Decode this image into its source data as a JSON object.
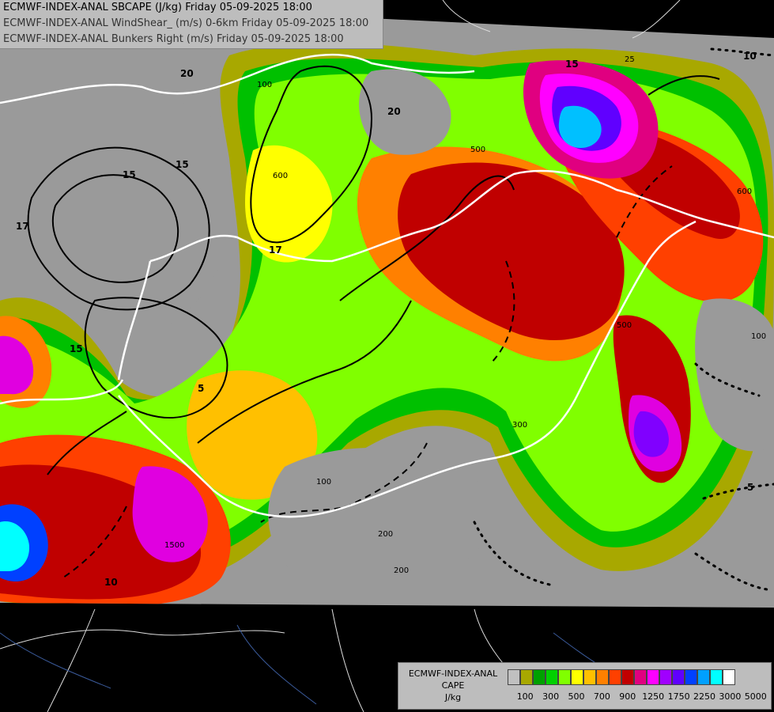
{
  "header": {
    "line1": "ECMWF-INDEX-ANAL SBCAPE (J/kg) Friday 05-09-2025 18:00",
    "line2": "ECMWF-INDEX-ANAL WindShear_ (m/s) 0-6km Friday 05-09-2025 18:00",
    "line3": "ECMWF-INDEX-ANAL Bunkers Right (m/s) Friday 05-09-2025 18:00"
  },
  "legend": {
    "title_line1": "ECMWF-INDEX-ANAL",
    "title_line2": "CAPE",
    "title_line3": "J/kg",
    "colors": [
      "#c0c0c0",
      "#a8a800",
      "#00a000",
      "#00d000",
      "#80ff00",
      "#ffff00",
      "#ffc000",
      "#ff8000",
      "#ff4000",
      "#c00000",
      "#e00080",
      "#ff00ff",
      "#a000ff",
      "#6000ff",
      "#0040ff",
      "#00a0ff",
      "#00ffff",
      "#ffffff"
    ],
    "ticks": [
      "100",
      "300",
      "500",
      "700",
      "900",
      "1250",
      "1750",
      "2250",
      "3000",
      "5000"
    ]
  },
  "map": {
    "contour_labels": [
      {
        "text": "20"
      },
      {
        "text": "15"
      },
      {
        "text": "20"
      },
      {
        "text": "15"
      },
      {
        "text": "17"
      },
      {
        "text": "17"
      },
      {
        "text": "15"
      },
      {
        "text": "15"
      },
      {
        "text": "10"
      },
      {
        "text": "10"
      },
      {
        "text": "5"
      },
      {
        "text": "5"
      },
      {
        "text": "500"
      },
      {
        "text": "600"
      },
      {
        "text": "100"
      },
      {
        "text": "100"
      },
      {
        "text": "1500"
      },
      {
        "text": "200"
      },
      {
        "text": "200"
      },
      {
        "text": "300"
      },
      {
        "text": "600"
      },
      {
        "text": "500"
      },
      {
        "text": "100"
      },
      {
        "text": "25"
      }
    ]
  }
}
